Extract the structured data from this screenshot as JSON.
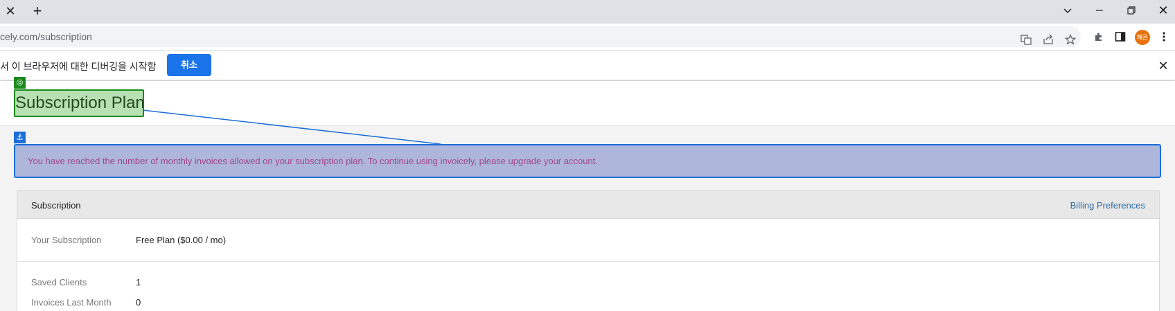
{
  "browser": {
    "url_domain": "cely.com",
    "url_path": "/subscription",
    "profile_initials": "혜은"
  },
  "infobar": {
    "message": "서 이 브라우저에 대한 디버깅을 시작함",
    "cancel_label": "취소"
  },
  "page": {
    "title": "Subscription Plan",
    "alert": "You have reached the number of monthly invoices allowed on your subscription plan. To continue using invoicely, please upgrade your account."
  },
  "subscription_panel": {
    "heading": "Subscription",
    "billing_link": "Billing Preferences",
    "rows": [
      {
        "label": "Your Subscription",
        "value": "Free Plan ($0.00 / mo)"
      },
      {
        "label": "Saved Clients",
        "value": "1"
      },
      {
        "label": "Invoices Last Month",
        "value": "0"
      }
    ]
  },
  "colors": {
    "accent_blue": "#1a73e8",
    "highlight_green": "#1b8a1b",
    "anchor_blue": "#1a6ed8",
    "alert_text": "#a0468e",
    "link": "#2e6da4"
  }
}
